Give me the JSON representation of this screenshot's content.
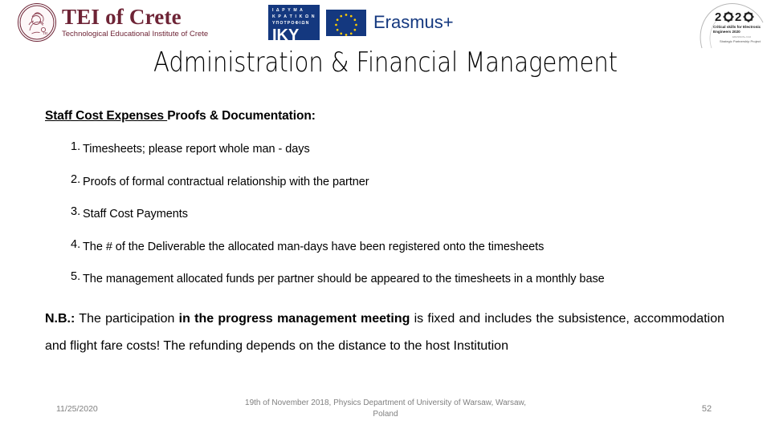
{
  "slide": {
    "title": "Administration & Financial Management",
    "background_color": "#ffffff"
  },
  "logos": {
    "tei": {
      "name": "TEI of Crete",
      "subtitle": "Technological Educational Institute of Crete",
      "color": "#6e2436",
      "emblem_icon": "crete-coin-emblem-icon"
    },
    "iky": {
      "line1": "Ι Δ Ρ Υ Μ Α",
      "line2": "Κ Ρ Α Τ Ι Κ Ω Ν",
      "line3": "ΥΠΟΤΡΟΦΙΩΝ",
      "acronym": "IKY",
      "color": "#14387f"
    },
    "erasmus": {
      "label": "Erasmus+",
      "flag_icon": "european-union-flag-icon",
      "color": "#14387f"
    },
    "project2020": {
      "year": "2020",
      "line1": "Critical skills for Electronic",
      "line2": "Engineers 2020",
      "line3": "ERASMUS+ KA2",
      "line4": "Strategic Partnership Project",
      "icon": "gear-head-profile-icon"
    }
  },
  "content": {
    "heading_underlined": "Staff Cost Expenses ",
    "heading_rest": "Proofs & Documentation:",
    "items": [
      {
        "number": "1.",
        "text": "Timesheets; please report whole man - days"
      },
      {
        "number": "2.",
        "text": "Proofs of formal contractual relationship with the partner"
      },
      {
        "number": "3.",
        "text": "Staff Cost Payments"
      },
      {
        "number": "4.",
        "text": "The # of the Deliverable the allocated man-days have been registered onto the timesheets"
      },
      {
        "number": "5.",
        "text": "The management allocated funds per partner should be appeared to the timesheets in a monthly base"
      }
    ],
    "nb": {
      "label": "N.B.:",
      "part1": " The participation ",
      "bold": "in the progress management meeting",
      "part2": " is fixed and includes the subsistence, accommodation and flight fare costs! The refunding depends on the distance to the host Institution"
    }
  },
  "footer": {
    "date": "11/25/2020",
    "event": "19th of November 2018, Physics Department of University of Warsaw, Warsaw, Poland",
    "page_number": "52",
    "color": "#808080"
  }
}
